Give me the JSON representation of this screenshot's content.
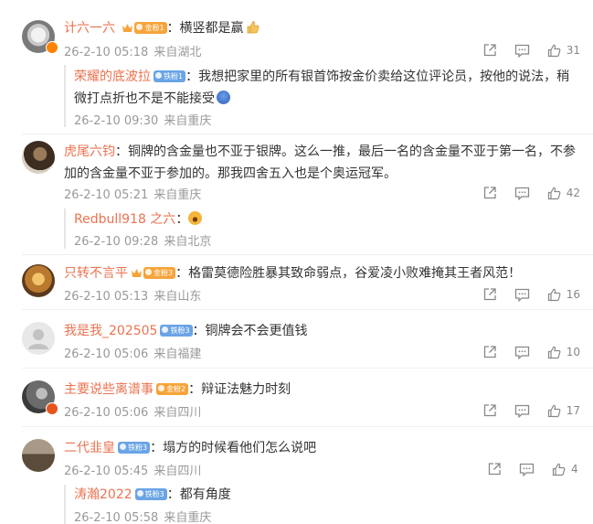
{
  "top_cut_text": "· · · · · ·",
  "comments": [
    {
      "username": "计六一六",
      "badge": "金粉1",
      "text": "横竖都是赢",
      "time": "26-2-10 05:18",
      "location": "来自湖北",
      "likes": "31",
      "reply": {
        "username": "荣耀的底波拉",
        "badge": "铁粉1",
        "text": "我想把家里的所有银首饰按金价卖给这位评论员，按他的说法，稍微打点折也不是不能接受",
        "time": "26-2-10 09:30",
        "location": "来自重庆"
      }
    },
    {
      "username": "虎尾六钧",
      "text": "铜牌的含金量也不亚于银牌。这么一推，最后一名的含金量不亚于第一名，不参加的含金量不亚于参加的。那我四舍五入也是个奥运冠军。",
      "time": "26-2-10 05:21",
      "location": "来自重庆",
      "likes": "42",
      "reply": {
        "username": "Redbull918 之六",
        "text": "",
        "time": "26-2-10 09:28",
        "location": "来自北京"
      }
    },
    {
      "username": "只转不言平",
      "badge": "金粉3",
      "text": "格雷莫德险胜暴其致命弱点，谷爱凌小败难掩其王者风范！",
      "time": "26-2-10 05:13",
      "location": "来自山东",
      "likes": "16"
    },
    {
      "username": "我是我_202505",
      "badge": "铁粉3",
      "text": "铜牌会不会更值钱",
      "time": "26-2-10 05:06",
      "location": "来自福建",
      "likes": "10"
    },
    {
      "username": "主要说些离谱事",
      "badge": "金粉2",
      "text": "辩证法魅力时刻",
      "time": "26-2-10 05:06",
      "location": "来自四川",
      "likes": "17"
    },
    {
      "username": "二代韭皇",
      "badge": "铁粉3",
      "text": "塌方的时候看他们怎么说吧",
      "time": "26-2-10 05:45",
      "location": "来自四川",
      "likes": "4",
      "reply": {
        "username": "涛瀚2022",
        "badge": "铁粉3",
        "text": "都有角度",
        "time": "26-2-10 05:58",
        "location": "来自重庆"
      }
    }
  ],
  "colors": {
    "username": "#eb7350",
    "meta": "#999999",
    "text": "#333333",
    "badge_gold": "#f6a43a",
    "badge_blue": "#6aa4e6"
  },
  "icons": [
    "share-icon",
    "comment-icon",
    "like-icon",
    "vip-crown-icon",
    "thumbs-up-emoji",
    "laugh-emoji",
    "angry-emoji"
  ]
}
